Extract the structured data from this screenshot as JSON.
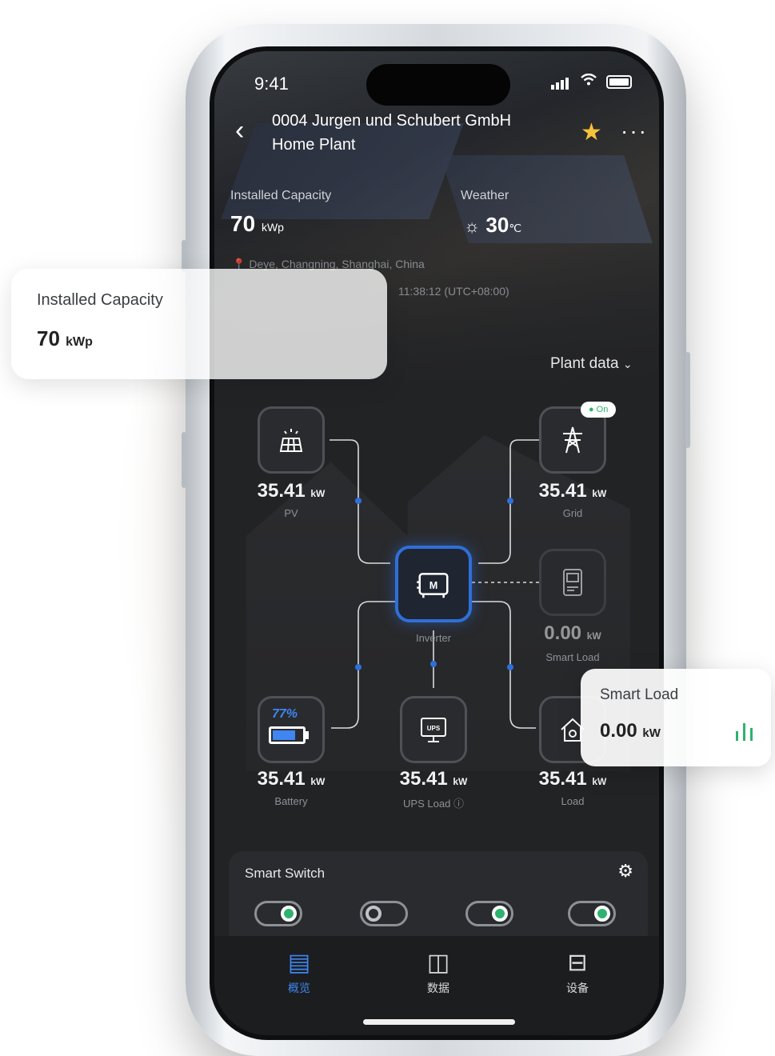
{
  "status_bar": {
    "time": "9:41"
  },
  "header": {
    "plant_title_line1": "0004 Jurgen und Schubert GmbH",
    "plant_title_line2": "Home Plant",
    "installed_capacity_label": "Installed Capacity",
    "installed_capacity_value": "70",
    "installed_capacity_unit": "kWp",
    "weather_label": "Weather",
    "weather_value": "30",
    "weather_unit": "℃",
    "location": "Deye, Changning, Shanghai, China",
    "local_time": "11:38:12 (UTC+08:00)"
  },
  "plant_data_dropdown": "Plant data",
  "flow": {
    "pv": {
      "value": "35.41",
      "unit": "kW",
      "label": "PV"
    },
    "grid": {
      "value": "35.41",
      "unit": "kW",
      "label": "Grid",
      "badge": "On"
    },
    "inverter": {
      "label": "Inverter",
      "icon_text": "M"
    },
    "smart_load": {
      "value": "0.00",
      "unit": "kW",
      "label": "Smart Load"
    },
    "battery": {
      "value": "35.41",
      "unit": "kW",
      "label": "Battery",
      "soc": "77%",
      "soc_level": 0.77
    },
    "ups": {
      "value": "35.41",
      "unit": "kW",
      "label": "UPS Load",
      "icon_text": "UPS"
    },
    "load": {
      "value": "35.41",
      "unit": "kW",
      "label": "Load"
    }
  },
  "smart_switch": {
    "title": "Smart Switch",
    "toggles": [
      true,
      false,
      true,
      true
    ]
  },
  "tabs": [
    {
      "label": "概览",
      "icon": "overview-icon",
      "active": true
    },
    {
      "label": "数据",
      "icon": "data-icon",
      "active": false
    },
    {
      "label": "设备",
      "icon": "device-icon",
      "active": false
    }
  ],
  "cards": {
    "capacity": {
      "title": "Installed Capacity",
      "value": "70",
      "unit": "kWp"
    },
    "smart_load": {
      "title": "Smart Load",
      "value": "0.00",
      "unit": "kW"
    }
  },
  "colors": {
    "accent_blue": "#2f6fd8",
    "toggle_green": "#2db36f",
    "star": "#f6c23b",
    "chart_green": "#2db36f"
  }
}
